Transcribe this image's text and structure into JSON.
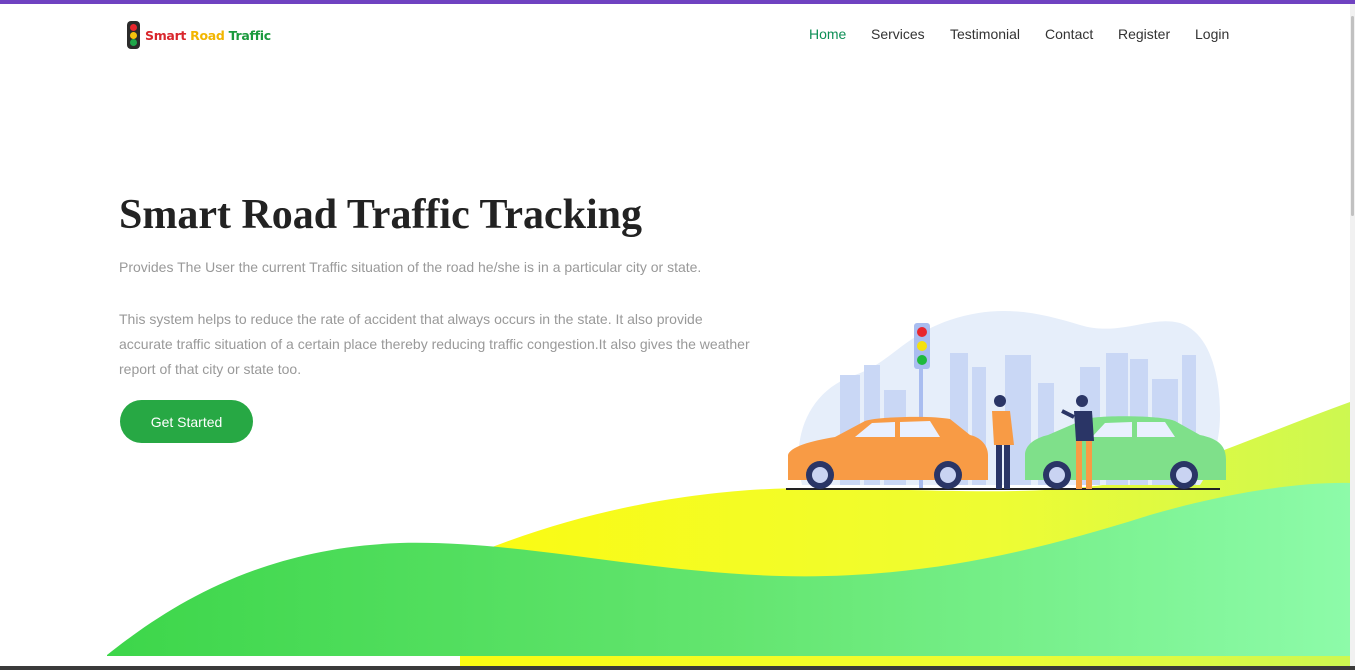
{
  "brand": {
    "word1": "Smart",
    "word2": "Road",
    "word3": "Traffic",
    "icon": "traffic-light-icon"
  },
  "nav": {
    "items": [
      {
        "label": "Home",
        "active": true
      },
      {
        "label": "Services",
        "active": false
      },
      {
        "label": "Testimonial",
        "active": false
      },
      {
        "label": "Contact",
        "active": false
      },
      {
        "label": "Register",
        "active": false
      },
      {
        "label": "Login",
        "active": false
      }
    ]
  },
  "hero": {
    "title": "Smart Road Traffic Tracking",
    "subtitle": "Provides The User the current Traffic situation of the road he/she is in a particular city or state.",
    "description": "This system helps to reduce the rate of accident that always occurs in the state. It also provide accurate traffic situation of a certain place thereby reducing traffic congestion.It also gives the weather report of that city or state too.",
    "cta_label": "Get Started"
  },
  "colors": {
    "top_bar": "#6f42c1",
    "nav_active": "#0d8f56",
    "cta_bg": "#27a844",
    "wave_yellow": "#f6fb1f",
    "wave_green_start": "#3dd64a",
    "wave_green_end": "#8dfba9"
  }
}
